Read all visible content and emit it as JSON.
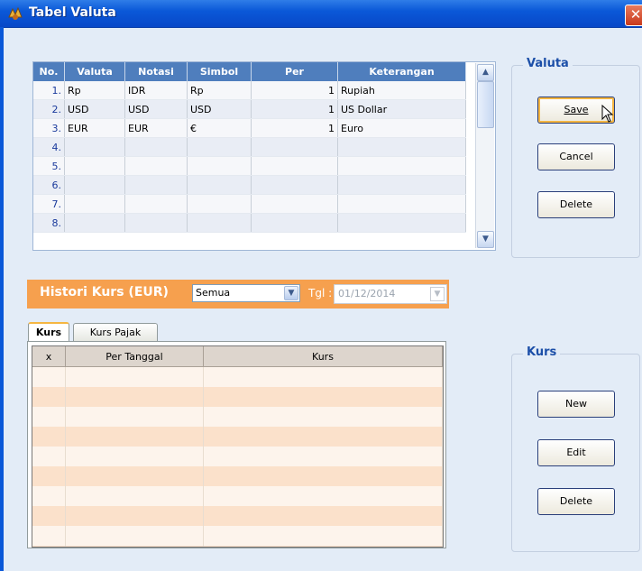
{
  "window": {
    "title": "Tabel Valuta",
    "close_glyph": "✕"
  },
  "currency_grid": {
    "columns": [
      "No.",
      "Valuta",
      "Notasi",
      "Simbol",
      "Per",
      "Keterangan"
    ],
    "rows": [
      {
        "no": "1.",
        "valuta": "Rp",
        "notasi": "IDR",
        "simbol": "Rp",
        "per": "1",
        "keterangan": "Rupiah"
      },
      {
        "no": "2.",
        "valuta": "USD",
        "notasi": "USD",
        "simbol": "USD",
        "per": "1",
        "keterangan": "US Dollar"
      },
      {
        "no": "3.",
        "valuta": "EUR",
        "notasi": "EUR",
        "simbol": "€",
        "per": "1",
        "keterangan": "Euro"
      },
      {
        "no": "4.",
        "valuta": "",
        "notasi": "",
        "simbol": "",
        "per": "",
        "keterangan": ""
      },
      {
        "no": "5.",
        "valuta": "",
        "notasi": "",
        "simbol": "",
        "per": "",
        "keterangan": ""
      },
      {
        "no": "6.",
        "valuta": "",
        "notasi": "",
        "simbol": "",
        "per": "",
        "keterangan": ""
      },
      {
        "no": "7.",
        "valuta": "",
        "notasi": "",
        "simbol": "",
        "per": "",
        "keterangan": ""
      },
      {
        "no": "8.",
        "valuta": "",
        "notasi": "",
        "simbol": "",
        "per": "",
        "keterangan": ""
      }
    ]
  },
  "valuta_group": {
    "title": "Valuta",
    "save": "Save",
    "cancel": "Cancel",
    "delete": "Delete"
  },
  "histori": {
    "label": "Histori Kurs (EUR)",
    "filter_value": "Semua",
    "tgl_label": "Tgl :",
    "date_value": "01/12/2014"
  },
  "tabs": {
    "kurs": "Kurs",
    "kurs_pajak": "Kurs Pajak"
  },
  "kurs_grid": {
    "columns": [
      "x",
      "Per Tanggal",
      "Kurs"
    ]
  },
  "kurs_group": {
    "title": "Kurs",
    "new": "New",
    "edit": "Edit",
    "delete": "Delete"
  },
  "colors": {
    "header_blue": "#4f7ebd",
    "histori_orange": "#f6a04e",
    "group_title": "#1c4fa8"
  }
}
